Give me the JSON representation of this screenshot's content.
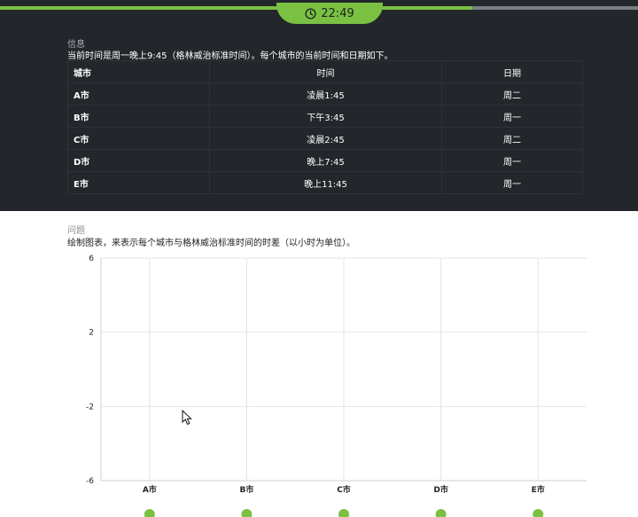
{
  "timer": {
    "time": "22:49",
    "icon": "clock-icon"
  },
  "progress": {
    "fraction": 0.74
  },
  "colors": {
    "accent": "#7ac143",
    "panel": "#23272b"
  },
  "info": {
    "label": "信息",
    "text": "当前时间是周一晚上9:45（格林威治标准时间）。每个城市的当前时间和日期如下。"
  },
  "table": {
    "headers": [
      "城市",
      "时间",
      "日期"
    ],
    "rows": [
      [
        "A市",
        "凌晨1:45",
        "周二"
      ],
      [
        "B市",
        "下午3:45",
        "周一"
      ],
      [
        "C市",
        "凌晨2:45",
        "周二"
      ],
      [
        "D市",
        "晚上7:45",
        "周一"
      ],
      [
        "E市",
        "晚上11:45",
        "周一"
      ]
    ]
  },
  "question": {
    "label": "问题",
    "text": "绘制图表，来表示每个城市与格林威治标准时间的时差（以小时为单位）。"
  },
  "chart_data": {
    "type": "bar",
    "categories": [
      "A市",
      "B市",
      "C市",
      "D市",
      "E市"
    ],
    "values": [
      null,
      null,
      null,
      null,
      null
    ],
    "ylim": [
      -6,
      6
    ],
    "yticks": [
      6,
      2,
      -2,
      -6
    ],
    "grid": true,
    "handle_color": "#7ac143"
  }
}
